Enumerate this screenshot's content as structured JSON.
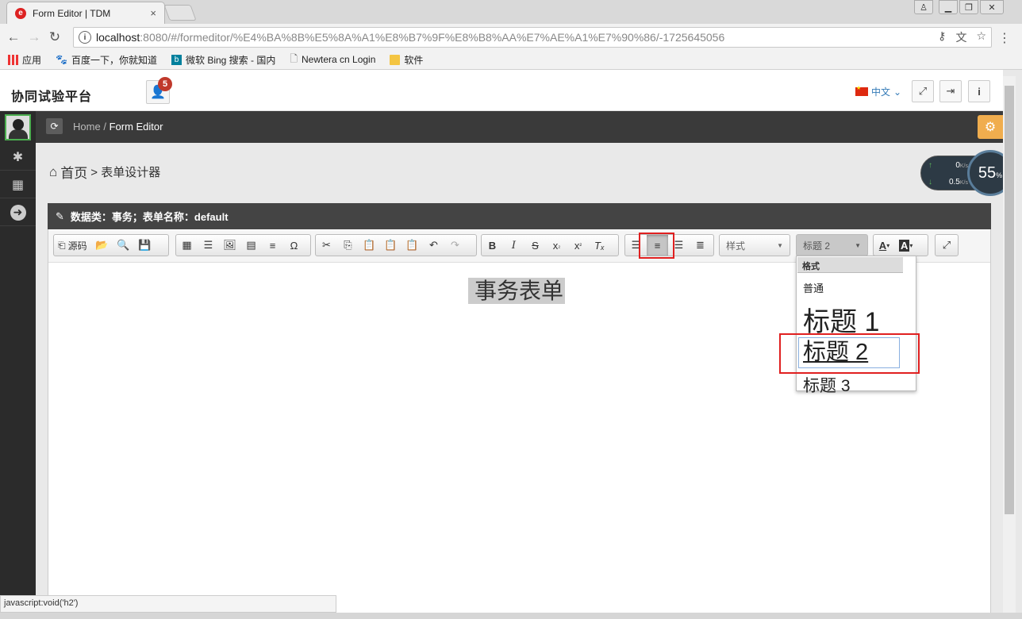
{
  "browser": {
    "tab_title": "Form Editor | TDM",
    "tab_close": "×",
    "url_host": "localhost",
    "url_path": ":8080/#/formeditor/%E4%BA%8B%E5%8A%A1%E8%B7%9F%E8%B8%AA%E7%AE%A1%E7%90%86/-1725645056",
    "bookmarks": [
      "应用",
      "百度一下，你就知道",
      "微软 Bing 搜索 - 国内",
      "Newtera cn Login",
      "软件"
    ],
    "status": "javascript:void('h2')"
  },
  "app": {
    "brand": "协同试验平台",
    "notif_count": "5",
    "lang": "中文",
    "breadcrumb_home": "Home",
    "breadcrumb_sep": "/",
    "breadcrumb_current": "Form Editor",
    "page_title": "首页",
    "page_sub": "> 表单设计器",
    "panel_title": "数据类：事务；表单名称：default",
    "speed_up": "0",
    "speed_down": "0.5",
    "speed_unit": "K/s",
    "cpu": "55",
    "cpu_unit": "%"
  },
  "editor": {
    "source_label": "源码",
    "styles_label": "样式",
    "format_label": "标题 2",
    "doc_title": "事务表单"
  },
  "format_menu": {
    "header": "格式",
    "items": [
      "普通",
      "标题 1",
      "标题 2",
      "标题 3"
    ]
  },
  "colors": {
    "accent": "#e02020",
    "bar": "#3a3a3a",
    "warning": "#f0ad4e"
  }
}
